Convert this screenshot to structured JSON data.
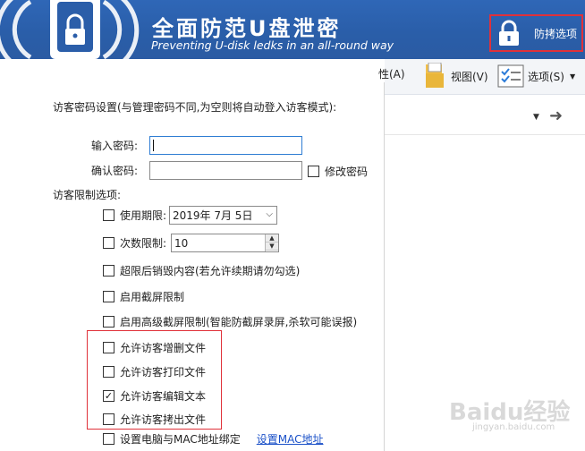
{
  "banner": {
    "title": "全面防范U盘泄密",
    "subtitle": "Preventing U-disk ledks in an all-round way",
    "protect_label": "防拷选项"
  },
  "toolbar": {
    "properties_label": "性(A)",
    "view_label": "视图(V)",
    "options_label": "选项(S)"
  },
  "dialog": {
    "heading": "访客密码设置(与管理密码不同,为空则将自动登入访客模式):",
    "password_label": "输入密码:",
    "password_value": "",
    "confirm_label": "确认密码:",
    "confirm_value": "",
    "modify_password_label": "修改密码",
    "restrictions_heading": "访客限制选项:",
    "expiry_label": "使用期限:",
    "expiry_date": "2019年  7月  5日",
    "count_label": "次数限制:",
    "count_value": "10",
    "options": [
      {
        "label": "超限后销毁内容(若允许续期请勿勾选)",
        "checked": false
      },
      {
        "label": "启用截屏限制",
        "checked": false
      },
      {
        "label": "启用高级截屏限制(智能防截屏录屏,杀软可能误报)",
        "checked": false
      },
      {
        "label": "允许访客增删文件",
        "checked": false
      },
      {
        "label": "允许访客打印文件",
        "checked": false
      },
      {
        "label": "允许访客编辑文本",
        "checked": true
      },
      {
        "label": "允许访客拷出文件",
        "checked": false
      },
      {
        "label": "设置电脑与MAC地址绑定",
        "checked": false
      }
    ],
    "mac_link": "设置MAC地址"
  },
  "watermark": {
    "main": "Baidu经验",
    "sub": "jingyan.baidu.com"
  },
  "colors": {
    "banner_blue": "#2b5fa8",
    "highlight_red": "#e0313a",
    "link_blue": "#1a50c8"
  }
}
